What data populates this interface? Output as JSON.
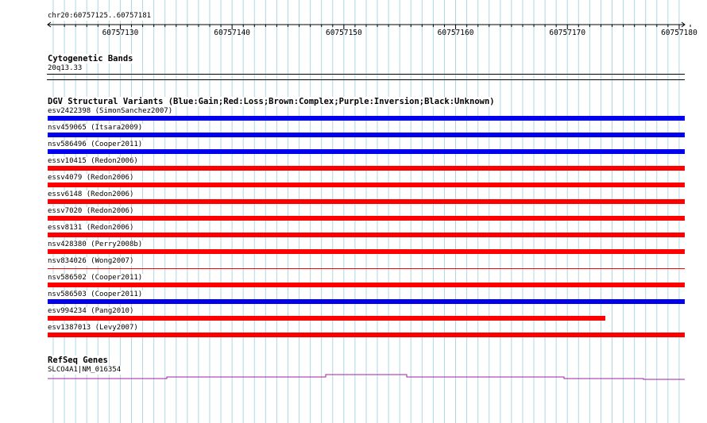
{
  "ruler": {
    "range_label": "chr20:60757125..60757181",
    "ticks": [
      {
        "label": "60757130",
        "position": 60757130
      },
      {
        "label": "60757140",
        "position": 60757140
      },
      {
        "label": "60757150",
        "position": 60757150
      },
      {
        "label": "60757160",
        "position": 60757160
      },
      {
        "label": "60757170",
        "position": 60757170
      },
      {
        "label": "60757180",
        "position": 60757180
      }
    ]
  },
  "cytobands": {
    "title": "Cytogenetic Bands",
    "band": "20q13.33"
  },
  "dgv": {
    "title": "DGV Structural Variants (Blue:Gain;Red:Loss;Brown:Complex;Purple:Inversion;Black:Unknown)",
    "colors": {
      "gain": "#0000ee",
      "loss": "#ff0000",
      "complex": "#8b4513",
      "inversion": "#800080",
      "unknown": "#000000"
    },
    "variants": [
      {
        "label": "esv2422398 (SimonSanchez2007)",
        "type": "gain",
        "style": "thick",
        "end_fraction": 1.0
      },
      {
        "label": "nsv459065 (Itsara2009)",
        "type": "gain",
        "style": "thick",
        "end_fraction": 1.0
      },
      {
        "label": "nsv586496 (Cooper2011)",
        "type": "gain",
        "style": "thick",
        "end_fraction": 1.0
      },
      {
        "label": "essv10415 (Redon2006)",
        "type": "loss",
        "style": "thick",
        "end_fraction": 1.0
      },
      {
        "label": "essv4079 (Redon2006)",
        "type": "loss",
        "style": "thick",
        "end_fraction": 1.0
      },
      {
        "label": "essv6148 (Redon2006)",
        "type": "loss",
        "style": "thick",
        "end_fraction": 1.0
      },
      {
        "label": "essv7020 (Redon2006)",
        "type": "loss",
        "style": "thick",
        "end_fraction": 1.0
      },
      {
        "label": "essv8131 (Redon2006)",
        "type": "loss",
        "style": "thick",
        "end_fraction": 1.0
      },
      {
        "label": "nsv428380 (Perry2008b)",
        "type": "loss",
        "style": "thick",
        "end_fraction": 1.0
      },
      {
        "label": "nsv834026 (Wong2007)",
        "type": "loss",
        "style": "thin",
        "end_fraction": 1.0
      },
      {
        "label": "nsv586502 (Cooper2011)",
        "type": "loss",
        "style": "thick",
        "end_fraction": 1.0
      },
      {
        "label": "nsv586503 (Cooper2011)",
        "type": "gain",
        "style": "thick",
        "end_fraction": 1.0
      },
      {
        "label": "esv994234 (Pang2010)",
        "type": "loss",
        "style": "thick",
        "end_fraction": 0.875
      },
      {
        "label": "esv1387013 (Levy2007)",
        "type": "loss",
        "style": "thick",
        "end_fraction": 1.0
      }
    ]
  },
  "refseq": {
    "title": "RefSeq Genes",
    "gene_label": "SLCO4A1|NM_016354",
    "gene_color": "#a020a0"
  },
  "gridline_color": "#add8e6"
}
